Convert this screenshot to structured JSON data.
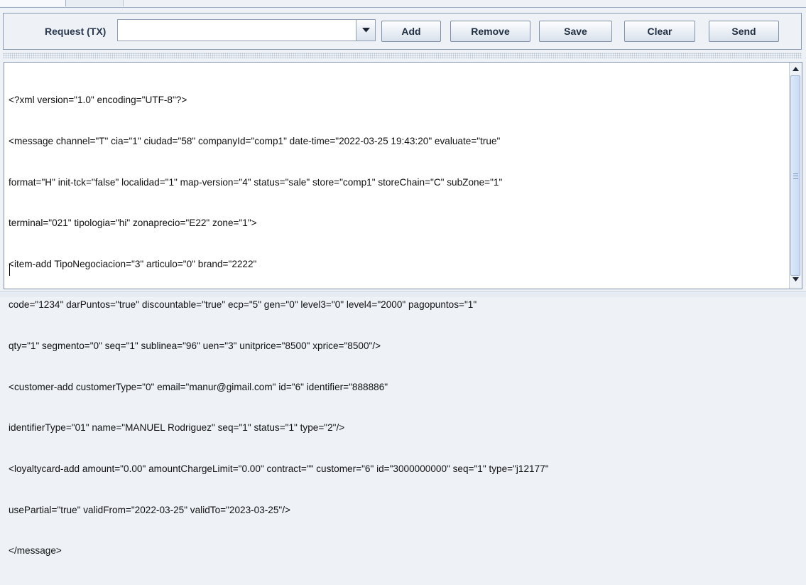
{
  "toolbar": {
    "request_label": "Request (TX)",
    "combo_value": "",
    "add_label": "Add",
    "remove_label": "Remove",
    "save_label": "Save",
    "clear_label": "Clear",
    "send_label": "Send"
  },
  "editor": {
    "lines": [
      "<?xml version=\"1.0\" encoding=\"UTF-8\"?>",
      "<message channel=\"T\" cia=\"1\" ciudad=\"58\" companyId=\"comp1\" date-time=\"2022-03-25 19:43:20\" evaluate=\"true\"",
      "format=\"H\" init-tck=\"false\" localidad=\"1\" map-version=\"4\" status=\"sale\" store=\"comp1\" storeChain=\"C\" subZone=\"1\"",
      "terminal=\"021\" tipologia=\"hi\" zonaprecio=\"E22\" zone=\"1\">",
      "<item-add TipoNegociacion=\"3\" articulo=\"0\" brand=\"2222\"",
      "code=\"1234\" darPuntos=\"true\" discountable=\"true\" ecp=\"5\" gen=\"0\" level3=\"0\" level4=\"2000\" pagopuntos=\"1\"",
      "qty=\"1\" segmento=\"0\" seq=\"1\" sublinea=\"96\" uen=\"3\" unitprice=\"8500\" xprice=\"8500\"/>",
      "<customer-add customerType=\"0\" email=\"manur@gimail.com\" id=\"6\" identifier=\"888886\"",
      "identifierType=\"01\" name=\"MANUEL Rodriguez\" seq=\"1\" status=\"1\" type=\"2\"/>",
      "<loyaltycard-add amount=\"0.00\" amountChargeLimit=\"0.00\" contract=\"\" customer=\"6\" id=\"3000000000\" seq=\"1\" type=\"j12177\"",
      "usePartial=\"true\" validFrom=\"2022-03-25\" validTo=\"2023-03-25\"/>",
      "</message>"
    ]
  },
  "icons": {
    "combo_arrow": "chevron-down-icon",
    "scroll_up": "arrow-up-icon",
    "scroll_down": "arrow-down-icon"
  }
}
